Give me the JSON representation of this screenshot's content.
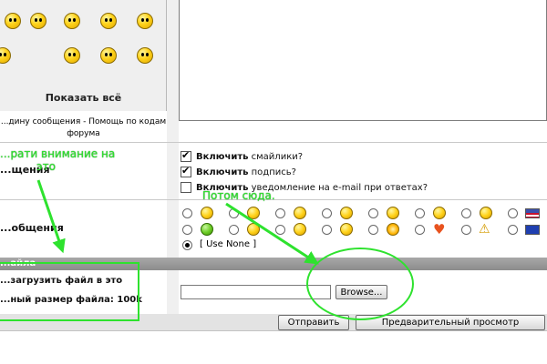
{
  "smilies": {
    "show_all": "Показать всё",
    "forum_help": "...дину сообщения - Помощь по кодам форума"
  },
  "rows": {
    "options_label": "...щения",
    "smilies_label": "...общения",
    "attachment_bar": "...айла",
    "attach_line1": "...загрузить файл в это",
    "attach_line2": "...ный размер файла: 100k"
  },
  "options": [
    {
      "bold": "Включить",
      "rest": " смайлики?",
      "checked": true
    },
    {
      "bold": "Включить",
      "rest": " подпись?",
      "checked": true
    },
    {
      "bold": "Включить",
      "rest": " уведомление на e-mail при ответах?",
      "checked": false
    }
  ],
  "emoticon_radio": {
    "use_none": "[ Use None ]"
  },
  "file": {
    "value": "",
    "browse_label": "Browse..."
  },
  "buttons": {
    "submit": "Отправить",
    "preview": "Предварительный проcмотр"
  },
  "annotations": {
    "note1_line1": "...рати внимание на",
    "note1_line2": "это",
    "note2": "Потом сюда.",
    "color": "#2ee22e"
  }
}
